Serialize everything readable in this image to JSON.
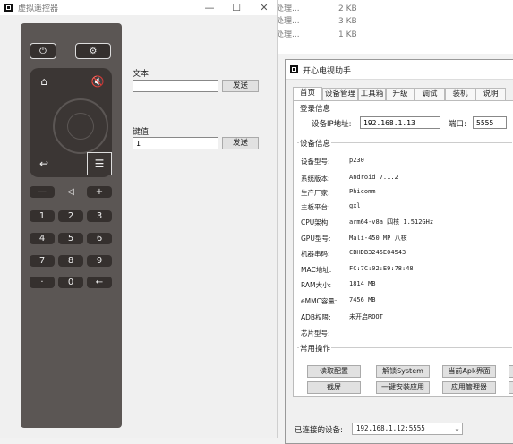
{
  "background_files": [
    {
      "name": "处理...",
      "size": "2 KB"
    },
    {
      "name": "处理...",
      "size": "3 KB"
    },
    {
      "name": "处理...",
      "size": "1 KB"
    }
  ],
  "remote_window": {
    "title": "虚拟遥控器",
    "controls": {
      "minimize": "—",
      "maximize": "☐",
      "close": "✕"
    },
    "buttons": {
      "power": "⏻",
      "settings": "⚙",
      "home": "⌂",
      "mute": "🔇",
      "back": "↩",
      "menu": "☰",
      "vol_down": "—",
      "vol_icon": "◁",
      "vol_up": "+",
      "digits": [
        "1",
        "2",
        "3",
        "4",
        "5",
        "6",
        "7",
        "8",
        "9"
      ],
      "dot": "·",
      "zero": "0",
      "backspace": "←"
    },
    "text_label": "文本:",
    "text_value": "",
    "text_send": "发送",
    "key_label": "键值:",
    "key_value": "1",
    "key_send": "发送"
  },
  "tv_window": {
    "title": "开心电视助手",
    "tabs": [
      "首页",
      "设备管理",
      "工具箱",
      "升级",
      "调试",
      "装机",
      "说明"
    ],
    "login": {
      "group": "登录信息",
      "ip_label": "设备IP地址:",
      "ip_value": "192.168.1.13",
      "port_label": "端口:",
      "port_value": "5555"
    },
    "device": {
      "group": "设备信息",
      "rows": [
        {
          "k": "设备型号:",
          "v": "p230"
        },
        {
          "k": "系统版本:",
          "v": "Android 7.1.2"
        },
        {
          "k": "生产厂家:",
          "v": "Phicomm"
        },
        {
          "k": "主板平台:",
          "v": "gxl"
        },
        {
          "k": "CPU架构:",
          "v": "arm64-v8a 四核 1.512GHz"
        },
        {
          "k": "GPU型号:",
          "v": "Mali-450 MP 八核"
        },
        {
          "k": "机器串码:",
          "v": "CBHDB3245E04543"
        },
        {
          "k": "MAC地址:",
          "v": "FC:7C:02:E9:78:48"
        },
        {
          "k": "RAM大小:",
          "v": "1814 MB"
        },
        {
          "k": "eMMC容量:",
          "v": "7456 MB"
        },
        {
          "k": "ADB权限:",
          "v": "未开启ROOT"
        },
        {
          "k": "芯片型号:",
          "v": ""
        }
      ]
    },
    "ops": {
      "group": "常用操作",
      "row1": [
        "读取配置",
        "解锁System",
        "当前Apk界面"
      ],
      "row2": [
        "截屏",
        "一键安装应用",
        "应用管理器"
      ]
    },
    "connected_label": "已连接的设备:",
    "connected_value": "192.168.1.12:5555"
  }
}
